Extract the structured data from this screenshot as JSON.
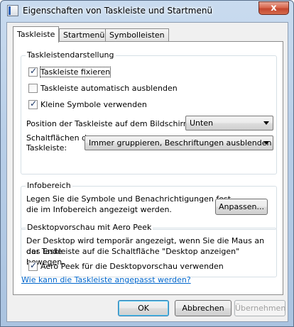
{
  "window": {
    "title": "Eigenschaften von Taskleiste und Startmenü",
    "close_glyph": "x"
  },
  "tabs": [
    {
      "label": "Taskleiste",
      "active": true
    },
    {
      "label": "Startmenü",
      "active": false
    },
    {
      "label": "Symbolleisten",
      "active": false
    }
  ],
  "taskbar_group": {
    "title": "Taskleistendarstellung",
    "checkboxes": [
      {
        "label": "Taskleiste fixieren",
        "checked": true
      },
      {
        "label": "Taskleiste automatisch ausblenden",
        "checked": false
      },
      {
        "label": "Kleine Symbole verwenden",
        "checked": true
      }
    ],
    "position_label": "Position der Taskleiste auf dem Bildschirm:",
    "position_value": "Unten",
    "buttons_label_line1": "Schaltflächen der",
    "buttons_label_line2": "Taskleiste:",
    "buttons_value": "Immer gruppieren, Beschriftungen ausblenden"
  },
  "notification_group": {
    "title": "Infobereich",
    "text_line1": "Legen Sie die Symbole und Benachrichtigungen fest,",
    "text_line2": "die im Infobereich angezeigt werden.",
    "customize_button": "Anpassen..."
  },
  "aero_group": {
    "title": "Desktopvorschau mit Aero Peek",
    "text_line1": "Der Desktop wird temporär angezeigt, wenn Sie die Maus an das Ende",
    "text_line2": "der Taskleiste auf die Schaltfläche \"Desktop anzeigen\" bewegen.",
    "checkbox_label": "Aero Peek für die Desktopvorschau verwenden",
    "checkbox_checked": true
  },
  "help_link": "Wie kann die Taskleiste angepasst werden?",
  "footer": {
    "ok": "OK",
    "cancel": "Abbrechen",
    "apply": "Übernehmen"
  }
}
